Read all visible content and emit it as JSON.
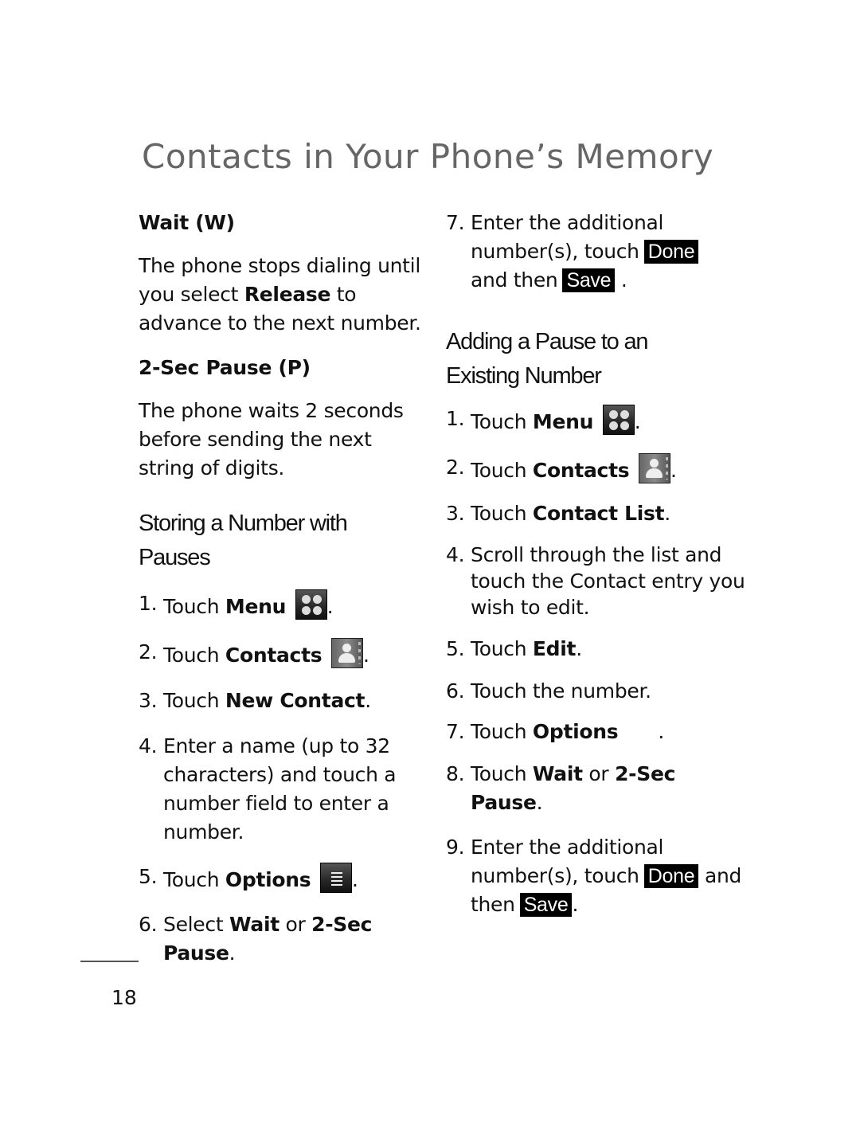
{
  "page": {
    "title": "Contacts in Your Phone’s Memory",
    "page_number": "18"
  },
  "left": {
    "wait_heading": "Wait (W)",
    "wait_desc": [
      "The phone stops dialing until you select ",
      "Release",
      " to advance to the next number."
    ],
    "pause_heading": "2-Sec Pause (P)",
    "pause_desc": "The phone waits 2 seconds before sending the next string of digits.",
    "section_title_1": "Storing a Number with",
    "section_title_2": "Pauses",
    "steps": [
      {
        "num": "1.",
        "pre": "Touch ",
        "bold": "Menu",
        "icon": "menu-grid-icon",
        "post": "."
      },
      {
        "num": "2.",
        "pre": "Touch ",
        "bold": "Contacts",
        "icon": "contacts-book-icon",
        "post": "."
      },
      {
        "num": "3.",
        "pre": "Touch ",
        "bold": "New Contact",
        "post": "."
      },
      {
        "num": "4.",
        "text": "Enter a name (up to 32 characters) and touch a number field to enter a number."
      },
      {
        "num": "5.",
        "pre": "Touch ",
        "bold": "Options",
        "icon": "options-list-icon",
        "post": "."
      },
      {
        "num": "6.",
        "pre": "Select ",
        "bold": "Wait",
        "mid": " or ",
        "bold2": "2-Sec Pause",
        "post": "."
      }
    ]
  },
  "right": {
    "step7": {
      "num": "7.",
      "line1": "Enter the additional",
      "line2": "number(s), touch",
      "done": "Done",
      "line3": "and then",
      "save": "Save",
      "post": "."
    },
    "section_title_1": "Adding a Pause to an",
    "section_title_2": "Existing Number",
    "steps": [
      {
        "num": "1.",
        "pre": "Touch ",
        "bold": "Menu",
        "icon": "menu-grid-icon",
        "post": "."
      },
      {
        "num": "2.",
        "pre": "Touch ",
        "bold": "Contacts",
        "icon": "contacts-book-icon",
        "post": "."
      },
      {
        "num": "3.",
        "pre": "Touch ",
        "bold": "Contact List",
        "post": "."
      },
      {
        "num": "4.",
        "text": "Scroll through the list and touch the Contact entry you wish to edit."
      },
      {
        "num": "5.",
        "pre": "Touch ",
        "bold": "Edit",
        "post": "."
      },
      {
        "num": "6.",
        "text": "Touch the number."
      },
      {
        "num": "7.",
        "pre": "Touch ",
        "bold": "Options",
        "post": "."
      },
      {
        "num": "8.",
        "pre": "Touch ",
        "bold": "Wait",
        "mid": " or ",
        "bold2": "2-Sec Pause",
        "post": "."
      }
    ],
    "step9": {
      "num": "9.",
      "line1": "Enter the additional",
      "line2": "number(s), touch",
      "done": "Done",
      "and": "and",
      "then": "then",
      "save": "Save",
      "post": "."
    }
  }
}
